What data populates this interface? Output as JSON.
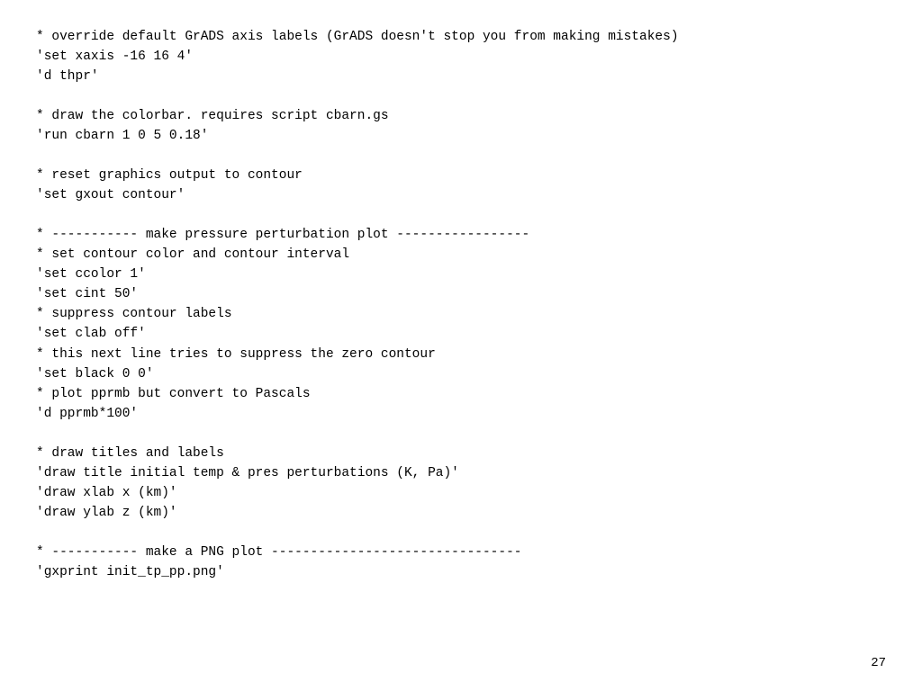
{
  "page": {
    "number": "27",
    "code_lines": [
      "* override default GrADS axis labels (GrADS doesn't stop you from making mistakes)",
      "'set xaxis -16 16 4'",
      "'d thpr'",
      "",
      "* draw the colorbar. requires script cbarn.gs",
      "'run cbarn 1 0 5 0.18'",
      "",
      "* reset graphics output to contour",
      "'set gxout contour'",
      "",
      "* ----------- make pressure perturbation plot -----------------",
      "* set contour color and contour interval",
      "'set ccolor 1'",
      "'set cint 50'",
      "* suppress contour labels",
      "'set clab off'",
      "* this next line tries to suppress the zero contour",
      "'set black 0 0'",
      "* plot pprmb but convert to Pascals",
      "'d pprmb*100'",
      "",
      "* draw titles and labels",
      "'draw title initial temp & pres perturbations (K, Pa)'",
      "'draw xlab x (km)'",
      "'draw ylab z (km)'",
      "",
      "* ----------- make a PNG plot --------------------------------",
      "'gxprint init_tp_pp.png'"
    ]
  }
}
